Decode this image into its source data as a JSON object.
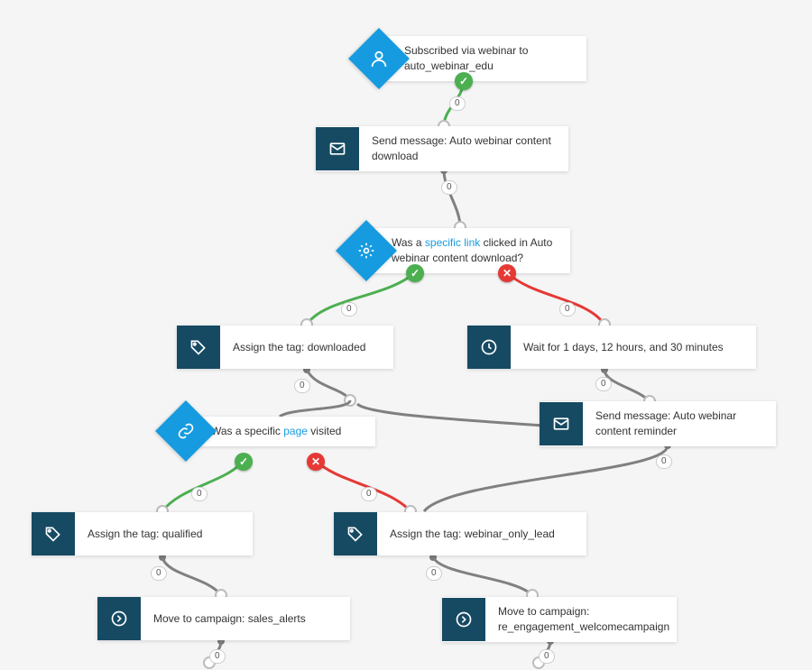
{
  "delay_default": "0",
  "nodes": {
    "trigger": {
      "text": "Subscribed via webinar to auto_webinar_edu",
      "icon": "user-icon"
    },
    "send1": {
      "text": "Send message: Auto webinar content download",
      "icon": "mail-icon"
    },
    "cond1": {
      "pre": "Was a ",
      "link": "specific link",
      "post": " clicked in Auto webinar content download?",
      "icon": "click-icon"
    },
    "tagDl": {
      "text": "Assign the tag: downloaded",
      "icon": "tag-icon"
    },
    "wait": {
      "text": "Wait for 1 days, 12 hours, and 30 minutes",
      "icon": "clock-icon"
    },
    "cond2": {
      "pre": "Was a specific ",
      "link": "page",
      "post": " visited",
      "icon": "link-icon"
    },
    "send2": {
      "text": "Send message: Auto webinar content reminder",
      "icon": "mail-icon"
    },
    "tagQual": {
      "text": "Assign the tag: qualified",
      "icon": "tag-icon"
    },
    "tagWol": {
      "text": "Assign the tag: webinar_only_lead",
      "icon": "tag-icon"
    },
    "moveSales": {
      "text": "Move to campaign: sales_alerts",
      "icon": "arrow-right-circle-icon"
    },
    "moveReeng": {
      "text": "Move to campaign: re_engagement_welcomecampaign",
      "icon": "arrow-right-circle-icon"
    }
  }
}
